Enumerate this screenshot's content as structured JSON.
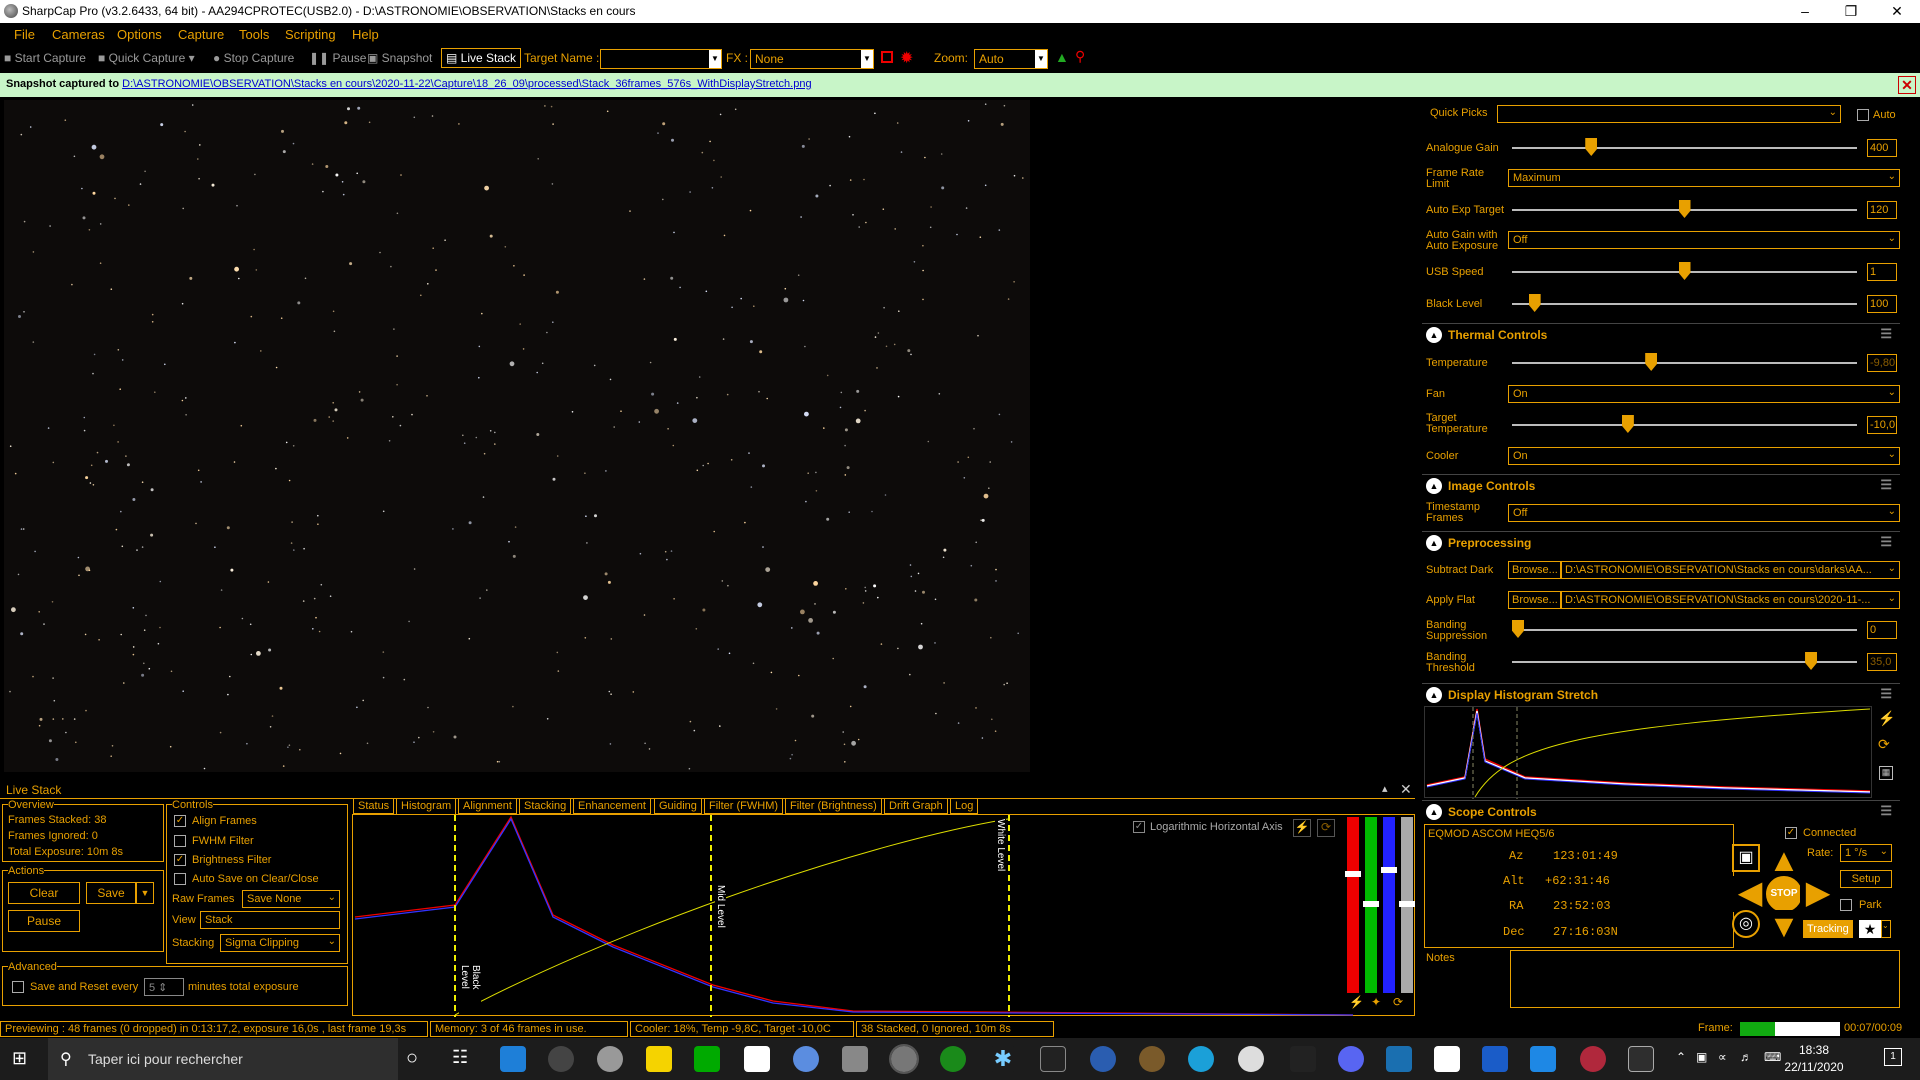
{
  "titlebar": {
    "title": "SharpCap Pro (v3.2.6433, 64 bit) - AA294CPROTEC(USB2.0) - D:\\ASTRONOMIE\\OBSERVATION\\Stacks en cours"
  },
  "menu": [
    "File",
    "Cameras",
    "Options",
    "Capture",
    "Tools",
    "Scripting",
    "Help"
  ],
  "toolbar": {
    "start_capture": "Start Capture",
    "quick_capture": "Quick Capture",
    "stop_capture": "Stop Capture",
    "pause": "Pause",
    "snapshot": "Snapshot",
    "live_stack": "Live Stack",
    "target_name_label": "Target Name :",
    "target_name_value": "",
    "fx_label": "FX :",
    "fx_value": "None",
    "zoom_label": "Zoom:",
    "zoom_value": "Auto"
  },
  "notify": {
    "prefix": "Snapshot captured to ",
    "path": "D:\\ASTRONOMIE\\OBSERVATION\\Stacks en cours\\2020-11-22\\Capture\\18_26_09\\processed\\Stack_36frames_576s_WithDisplayStretch.png"
  },
  "right": {
    "quick_picks": "Quick Picks",
    "auto": "Auto",
    "analogue_gain": {
      "label": "Analogue Gain",
      "value": "400",
      "level": 0.22
    },
    "frame_rate": {
      "label1": "Frame Rate",
      "label2": "Limit",
      "value": "Maximum"
    },
    "auto_exp": {
      "label": "Auto Exp Target",
      "value": "120",
      "level": 0.5
    },
    "auto_gain": {
      "label1": "Auto Gain with",
      "label2": "Auto Exposure",
      "value": "Off"
    },
    "usb_speed": {
      "label": "USB Speed",
      "value": "1",
      "level": 0.5
    },
    "black_level": {
      "label": "Black Level",
      "value": "100",
      "level": 0.05
    },
    "thermal_title": "Thermal Controls",
    "temperature": {
      "label": "Temperature",
      "value": "-9,80",
      "level": 0.4
    },
    "fan": {
      "label": "Fan",
      "value": "On"
    },
    "target_temp": {
      "label1": "Target",
      "label2": "Temperature",
      "value": "-10,0",
      "level": 0.33
    },
    "cooler": {
      "label": "Cooler",
      "value": "On"
    },
    "image_title": "Image Controls",
    "timestamp": {
      "label1": "Timestamp",
      "label2": "Frames",
      "value": "Off"
    },
    "pre_title": "Preprocessing",
    "subtract_dark": {
      "label": "Subtract Dark",
      "browse": "Browse...",
      "value": "D:\\ASTRONOMIE\\OBSERVATION\\Stacks en cours\\darks\\AA..."
    },
    "apply_flat": {
      "label": "Apply Flat",
      "browse": "Browse...",
      "value": "D:\\ASTRONOMIE\\OBSERVATION\\Stacks en cours\\2020-11-..."
    },
    "banding_supp": {
      "label1": "Banding",
      "label2": "Suppression",
      "value": "0",
      "level": 0.0
    },
    "banding_thr": {
      "label1": "Banding",
      "label2": "Threshold",
      "value": "35,0",
      "level": 0.88
    },
    "dhs_title": "Display Histogram Stretch",
    "scope_title": "Scope Controls",
    "scope": {
      "mount": "EQMOD ASCOM HEQ5/6",
      "az_label": "Az",
      "az": "123:01:49",
      "alt_label": "Alt",
      "alt": "+62:31:46",
      "ra_label": "RA",
      "ra": "23:52:03",
      "dec_label": "Dec",
      "dec": "27:16:03N",
      "connected": "Connected",
      "rate_label": "Rate:",
      "rate": "1 °/s",
      "setup": "Setup",
      "park": "Park",
      "tracking": "Tracking",
      "stop": "STOP",
      "notes": "Notes"
    }
  },
  "livestack": {
    "title": "Live Stack",
    "overview": "Overview",
    "frames_stacked": "Frames Stacked: 38",
    "frames_ignored": "Frames Ignored:  0",
    "total_exposure": "Total Exposure:   10m 8s",
    "actions": "Actions",
    "clear": "Clear",
    "save": "Save",
    "pause": "Pause",
    "advanced": "Advanced",
    "save_reset": "Save and Reset every",
    "minutes_value": "5",
    "minutes_text": "minutes total exposure",
    "controls": "Controls",
    "align": "Align Frames",
    "fwhm": "FWHM Filter",
    "brightness": "Brightness Filter",
    "autosave": "Auto Save on Clear/Close",
    "raw_frames_label": "Raw Frames",
    "raw_frames": "Save None",
    "view_label": "View",
    "view": "Stack",
    "stacking_label": "Stacking",
    "stacking": "Sigma Clipping",
    "tabs": [
      "Status",
      "Histogram",
      "Alignment",
      "Stacking",
      "Enhancement",
      "Guiding",
      "Filter (FWHM)",
      "Filter (Brightness)",
      "Drift Graph",
      "Log"
    ],
    "log_axis": "Logarithmic Horizontal Axis",
    "black_level": "Black Level",
    "mid_level": "Mid Level",
    "white_level": "White Level"
  },
  "status": {
    "preview": "Previewing : 48 frames (0 dropped) in 0:13:17,2, exposure 16,0s , last frame 19,3s",
    "memory": "Memory: 3 of 46 frames in use.",
    "cooler": "Cooler: 18%, Temp -9,8C, Target -10,0C",
    "stacked": "38 Stacked, 0 Ignored, 10m 8s",
    "frame_label": "Frame:",
    "frame_time": "00:07/00:09",
    "progress": 0.35
  },
  "taskbar": {
    "search": "Taper ici pour rechercher",
    "time": "18:38",
    "date": "22/11/2020",
    "notif": "1"
  },
  "colors": {
    "accent": "#e8a000",
    "notify_bg": "#c8f5c8"
  }
}
